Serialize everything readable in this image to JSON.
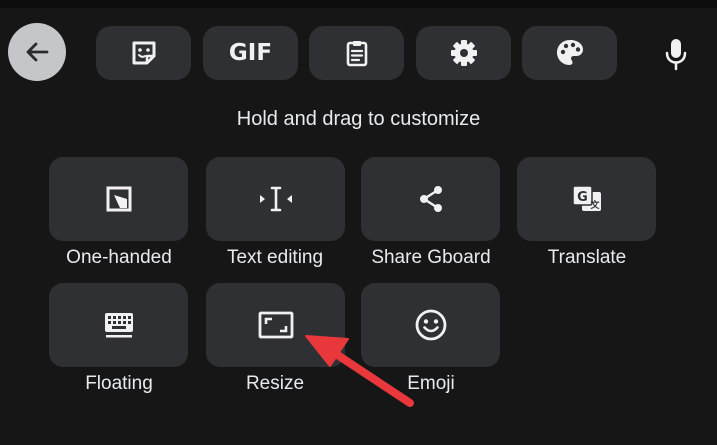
{
  "toolbar": {
    "back": {
      "icon": "back-arrow-icon"
    },
    "buttons": [
      {
        "icon": "sticker-icon"
      },
      {
        "icon": "gif-icon",
        "text": "GIF"
      },
      {
        "icon": "clipboard-icon"
      },
      {
        "icon": "settings-gear-icon"
      },
      {
        "icon": "palette-icon"
      }
    ],
    "mic": {
      "icon": "microphone-icon"
    }
  },
  "heading": "Hold and drag to customize",
  "tiles": [
    {
      "label": "One-handed",
      "icon": "one-handed-icon"
    },
    {
      "label": "Text editing",
      "icon": "text-cursor-icon"
    },
    {
      "label": "Share Gboard",
      "icon": "share-icon"
    },
    {
      "label": "Translate",
      "icon": "translate-icon"
    },
    {
      "label": "Floating",
      "icon": "keyboard-icon"
    },
    {
      "label": "Resize",
      "icon": "resize-icon"
    },
    {
      "label": "Emoji",
      "icon": "smiley-icon"
    }
  ],
  "annotation": {
    "icon": "red-arrow-icon",
    "color": "#e8383b"
  },
  "colors": {
    "background": "#161617",
    "tile": "#2f3033",
    "back_button": "#c5c6ca",
    "text": "#e8eaed"
  }
}
